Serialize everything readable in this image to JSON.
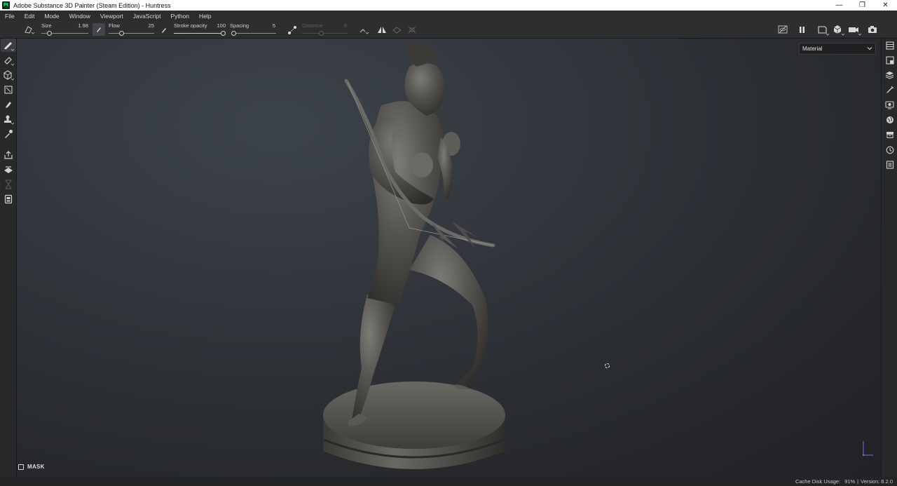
{
  "window": {
    "app_icon_text": "Pt",
    "title": "Adobe Substance 3D Painter (Steam Edition) - Huntress",
    "minimize": "—",
    "restore": "❐",
    "close": "✕"
  },
  "menu": [
    "File",
    "Edit",
    "Mode",
    "Window",
    "Viewport",
    "JavaScript",
    "Python",
    "Help"
  ],
  "toolbar": {
    "size": {
      "label": "Size",
      "value": "1.98"
    },
    "flow": {
      "label": "Flow",
      "value": "25"
    },
    "stroke_opacity": {
      "label": "Stroke opacity",
      "value": "100"
    },
    "spacing": {
      "label": "Spacing",
      "value": "5"
    },
    "distance": {
      "label": "Distance",
      "value": "8"
    }
  },
  "viewport": {
    "channel_dropdown": "Material",
    "mask_label": "MASK"
  },
  "status": {
    "cache_label": "Cache Disk Usage:",
    "cache_value": "91%",
    "separator": "|",
    "version": "Version: 8.2.0"
  },
  "colors": {
    "accent": "#31ff95",
    "panel": "#2d2e30",
    "viewport_bg": "#32363c"
  }
}
